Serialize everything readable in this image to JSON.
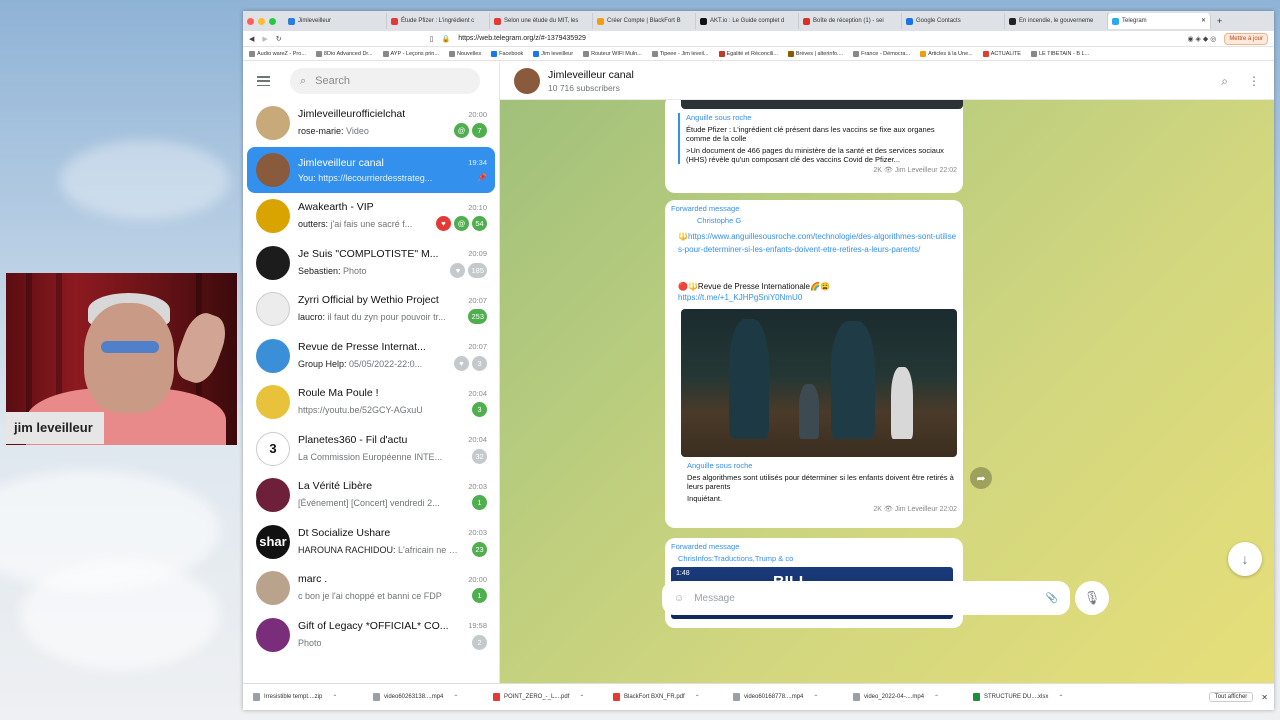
{
  "webcam": {
    "label": "jim leveilleur"
  },
  "browser": {
    "tabs": [
      {
        "label": "Jimleveilleur"
      },
      {
        "label": "Étude Pfizer : L'ingrédient c"
      },
      {
        "label": "Selon une étude du MIT, les"
      },
      {
        "label": "Créer Compte | BlackFort B"
      },
      {
        "label": "AKT.io : Le Guide complet d"
      },
      {
        "label": "Boîte de réception (1) - sei"
      },
      {
        "label": "Google Contacts"
      },
      {
        "label": "En incendie, le gouverneme"
      },
      {
        "label": "Telegram"
      }
    ],
    "url": "https://web.telegram.org/z/#-1379435929",
    "update_label": "Mettre à jour",
    "bookmarks": [
      "Audio wareZ - Pro...",
      "8Dio Advanced Dr...",
      "AYP - Leçons prin...",
      "Nouvelles",
      "Facebook",
      "Jim leveilleur",
      "Routeur WIFI Muln...",
      "Tipeee - Jim leveil...",
      "Egalité et Réconcili...",
      "Brèves | alterinfo....",
      "France - Démocra...",
      "Articles à la Une...",
      "ACTUALITE",
      "LE TIBETAIN - B L..."
    ]
  },
  "sidebar": {
    "search_placeholder": "Search",
    "chats": [
      {
        "name": "Jimleveilleurofficielchat",
        "time": "20:00",
        "sender": "rose-marie:",
        "preview": "Video",
        "badges": [
          {
            "text": "@",
            "kind": "green"
          },
          {
            "text": "7",
            "kind": "green"
          }
        ],
        "avatar_color": "#c7a97a",
        "avatar_text": "",
        "active": false
      },
      {
        "name": "Jimleveilleur canal",
        "time": "19:34",
        "sender": "You:",
        "preview": "https://lecourrierdesstrateg...",
        "badges": [],
        "avatar_color": "#8a5a3c",
        "avatar_text": "",
        "active": true
      },
      {
        "name": "Awakearth - VIP",
        "time": "20:10",
        "sender": "outters:",
        "preview": "j'ai fais une sacré f...",
        "badges": [
          {
            "text": "♥",
            "kind": "red"
          },
          {
            "text": "@",
            "kind": "green"
          },
          {
            "text": "54",
            "kind": "green"
          }
        ],
        "avatar_color": "#d9a400",
        "avatar_text": "",
        "active": false
      },
      {
        "name": "Je Suis \"COMPLOTISTE\" M...",
        "time": "20:09",
        "sender": "Sebastien:",
        "preview": "Photo",
        "badges": [
          {
            "text": "♥",
            "kind": "grey"
          },
          {
            "text": "185",
            "kind": "grey"
          }
        ],
        "avatar_color": "#1c1c1c",
        "avatar_text": "",
        "active": false
      },
      {
        "name": "Zyrri Official by Wethio Project",
        "time": "20:07",
        "sender": "laucro:",
        "preview": "il faut du zyn pour pouvoir tr...",
        "badges": [
          {
            "text": "253",
            "kind": "green"
          }
        ],
        "avatar_color": "#ececec",
        "avatar_text": "",
        "active": false
      },
      {
        "name": "Revue de Presse Internat...",
        "time": "20:07",
        "sender": "Group Help:",
        "preview": "05/05/2022-22:0...",
        "badges": [
          {
            "text": "♥",
            "kind": "grey"
          },
          {
            "text": "3",
            "kind": "grey"
          }
        ],
        "avatar_color": "#3a8fd6",
        "avatar_text": "",
        "active": false
      },
      {
        "name": "Roule Ma Poule !",
        "time": "20:04",
        "sender": "",
        "preview": "https://youtu.be/52GCY-AGxuU",
        "badges": [
          {
            "text": "3",
            "kind": "green"
          }
        ],
        "avatar_color": "#e7c23a",
        "avatar_text": "",
        "active": false
      },
      {
        "name": "Planetes360 - Fil d'actu",
        "time": "20:04",
        "sender": "",
        "preview": "La Commission Européenne INTE...",
        "badges": [
          {
            "text": "32",
            "kind": "grey"
          }
        ],
        "avatar_color": "#ffffff",
        "avatar_text": "3",
        "active": false
      },
      {
        "name": "La Vérité Libère",
        "time": "20:03",
        "sender": "",
        "preview": "[Événement] [Concert] vendredi 2...",
        "badges": [
          {
            "text": "1",
            "kind": "green"
          }
        ],
        "avatar_color": "#6e1f3a",
        "avatar_text": "",
        "active": false
      },
      {
        "name": "Dt Socialize Ushare",
        "time": "20:03",
        "sender": "HAROUNA RACHIDOU:",
        "preview": "L'africain ne c...",
        "badges": [
          {
            "text": "23",
            "kind": "green"
          }
        ],
        "avatar_color": "#111111",
        "avatar_text": "shar",
        "active": false
      },
      {
        "name": "marc .",
        "time": "20:00",
        "sender": "",
        "preview": "c bon je l'ai choppé et banni ce FDP",
        "badges": [
          {
            "text": "1",
            "kind": "green"
          }
        ],
        "avatar_color": "#b9a38c",
        "avatar_text": "",
        "active": false
      },
      {
        "name": "Gift of Legacy *OFFICIAL* CO...",
        "time": "19:58",
        "sender": "",
        "preview": "Photo",
        "badges": [
          {
            "text": "2",
            "kind": "grey"
          }
        ],
        "avatar_color": "#7a2d7a",
        "avatar_text": "",
        "active": false
      }
    ]
  },
  "channel": {
    "title": "Jimleveilleur canal",
    "subscribers": "10 716 subscribers"
  },
  "messages": {
    "m1": {
      "source": "Anguille sous roche",
      "title": "Étude Pfizer : L'ingrédient clé présent dans les vaccins se fixe aux organes comme de la colle",
      "desc": ">Un document de 466 pages du ministère de la santé et des services sociaux (HHS) révèle qu'un composant clé des vaccins Covid de Pfizer...",
      "meta": "2K 👁 Jim Leveilleur 22:02"
    },
    "m2": {
      "forwarded_label": "Forwarded message",
      "from": "Christophe G",
      "link1": "https://www.anguillesousroche.com/technologie/des-algorithmes-sont-utilises-pour-determiner-si-les-enfants-doivent-etre-retires-a-leurs-parents/",
      "revue": "Revue de Presse Internationale",
      "link2": "https://t.me/+1_KJHPgSniY0NmU0",
      "source": "Anguille sous roche",
      "title": "Des algorithmes sont utilisés pour déterminer si les enfants doivent être retirés à leurs parents",
      "desc": "Inquiétant.",
      "meta": "2K 👁 Jim Leveilleur 22:02"
    },
    "m3": {
      "forwarded_label": "Forwarded message",
      "from": "ChrisInfos:Traductions,Trump & co",
      "video_duration": "1:48",
      "video_text": "BILL GATES"
    }
  },
  "composer": {
    "placeholder": "Message"
  },
  "downloads": {
    "items": [
      "Irresistible tempt....zip",
      "video60263138....mp4",
      "POINT_ZERO_-_L....pdf",
      "BlackFort BXN_FR.pdf",
      "video60168778....mp4",
      "video_2022-04-....mp4",
      "STRUCTURE DU....xlsx"
    ],
    "show_all": "Tout afficher"
  }
}
